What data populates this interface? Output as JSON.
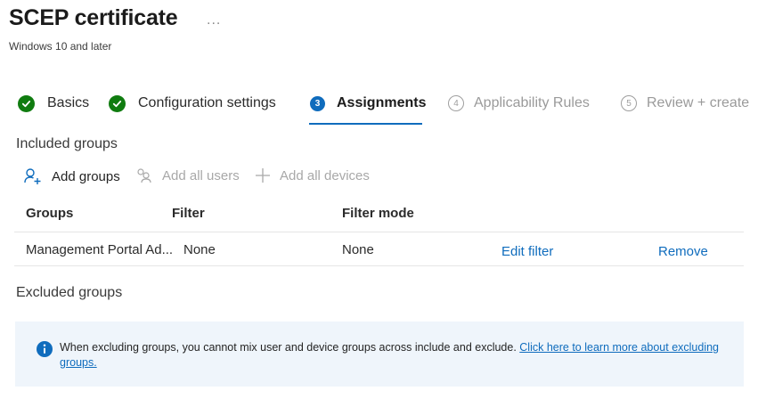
{
  "header": {
    "title": "SCEP certificate",
    "more_label": "...",
    "subtitle": "Windows 10 and later"
  },
  "steps": [
    {
      "label": "Basics",
      "state": "done",
      "number": ""
    },
    {
      "label": "Configuration settings",
      "state": "done",
      "number": ""
    },
    {
      "label": "Assignments",
      "state": "active",
      "number": "3"
    },
    {
      "label": "Applicability Rules",
      "state": "pending",
      "number": "4"
    },
    {
      "label": "Review + create",
      "state": "pending",
      "number": "5"
    }
  ],
  "included": {
    "heading": "Included groups",
    "toolbar": {
      "add_groups": "Add groups",
      "add_all_users": "Add all users",
      "add_all_devices": "Add all devices"
    },
    "columns": [
      "Groups",
      "Filter",
      "Filter mode"
    ],
    "rows": [
      {
        "group": "Management Portal Ad...",
        "filter": "None",
        "filter_mode": "None",
        "edit_filter": "Edit filter",
        "remove": "Remove"
      }
    ]
  },
  "excluded": {
    "heading": "Excluded groups",
    "info": {
      "text": "When excluding groups, you cannot mix user and device groups across include and exclude. ",
      "link": "Click here to learn more about excluding groups."
    }
  },
  "colors": {
    "accent": "#0f6cbd",
    "success": "#107c10",
    "info_background": "#eff5fb"
  }
}
